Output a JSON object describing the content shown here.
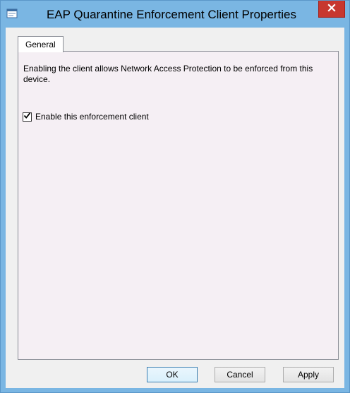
{
  "window": {
    "title": "EAP Quarantine Enforcement Client Properties",
    "close_label": "x"
  },
  "tabs": [
    {
      "label": "General",
      "selected": true
    }
  ],
  "general": {
    "description": "Enabling the client allows Network Access Protection to be enforced from this device.",
    "checkbox_label": "Enable this enforcement client",
    "checkbox_checked": true
  },
  "buttons": {
    "ok": "OK",
    "cancel": "Cancel",
    "apply": "Apply"
  },
  "colors": {
    "titlebar": "#7ab6e3",
    "close": "#c7372f",
    "panel": "#f5eff4"
  },
  "icons": {
    "window_icon": "properties-icon",
    "close_icon": "close-icon",
    "check_icon": "checkmark-icon"
  }
}
